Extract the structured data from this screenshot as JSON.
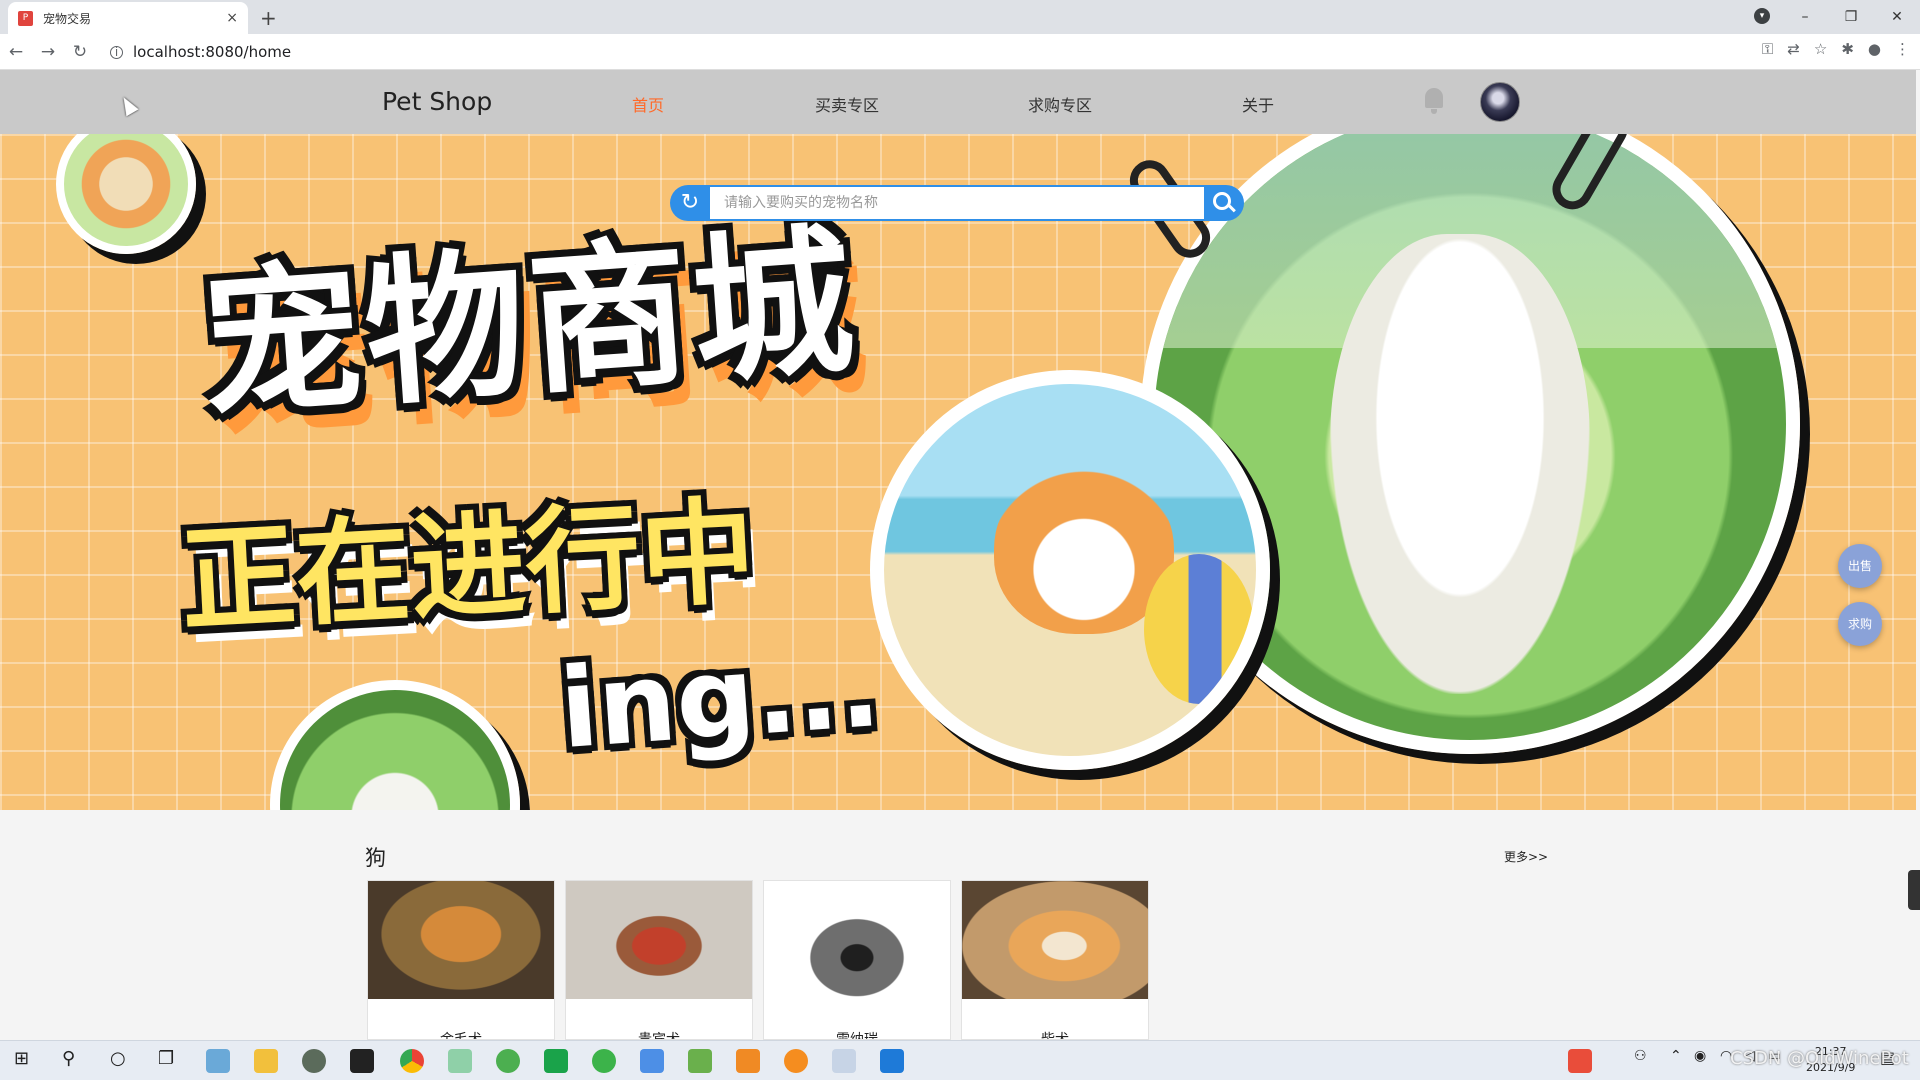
{
  "browser": {
    "tab_title": "宠物交易",
    "tab_close": "×",
    "new_tab": "+",
    "url": "localhost:8080/home",
    "back": "←",
    "forward": "→",
    "reload": "↻",
    "info_icon": "i",
    "window_controls": {
      "minimize": "–",
      "restore": "❐",
      "close": "✕"
    },
    "toolbar_icons": [
      "key-icon",
      "translate-icon",
      "star-icon",
      "extensions-icon",
      "profile-icon",
      "menu-icon"
    ]
  },
  "header": {
    "brand": "Pet Shop",
    "nav": [
      {
        "label": "首页",
        "active": true
      },
      {
        "label": "买卖专区",
        "active": false
      },
      {
        "label": "求购专区",
        "active": false
      },
      {
        "label": "关于",
        "active": false
      }
    ]
  },
  "hero": {
    "title": "宠物商城",
    "subtitle": "正在进行中",
    "tail": "ing...",
    "search_placeholder": "请输入要购买的宠物名称"
  },
  "fabs": {
    "sell": "出售",
    "buy": "求购"
  },
  "section": {
    "title": "狗",
    "more": "更多>>",
    "cards": [
      {
        "label": "金毛犬",
        "colors": [
          "#8a6a3a",
          "#d58a3a",
          "#4a3a2a"
        ]
      },
      {
        "label": "贵宾犬",
        "colors": [
          "#cfc9c1",
          "#c2402b",
          "#eae6e0"
        ]
      },
      {
        "label": "雪纳瑞",
        "colors": [
          "#ffffff",
          "#6e6e6e",
          "#1f1f1f"
        ]
      },
      {
        "label": "柴犬",
        "colors": [
          "#c29a6b",
          "#e9a659",
          "#5a4632"
        ]
      }
    ]
  },
  "taskbar": {
    "time": "21:37",
    "date": "2021/9/9",
    "watermark": "CSDN @OldWinePot"
  }
}
